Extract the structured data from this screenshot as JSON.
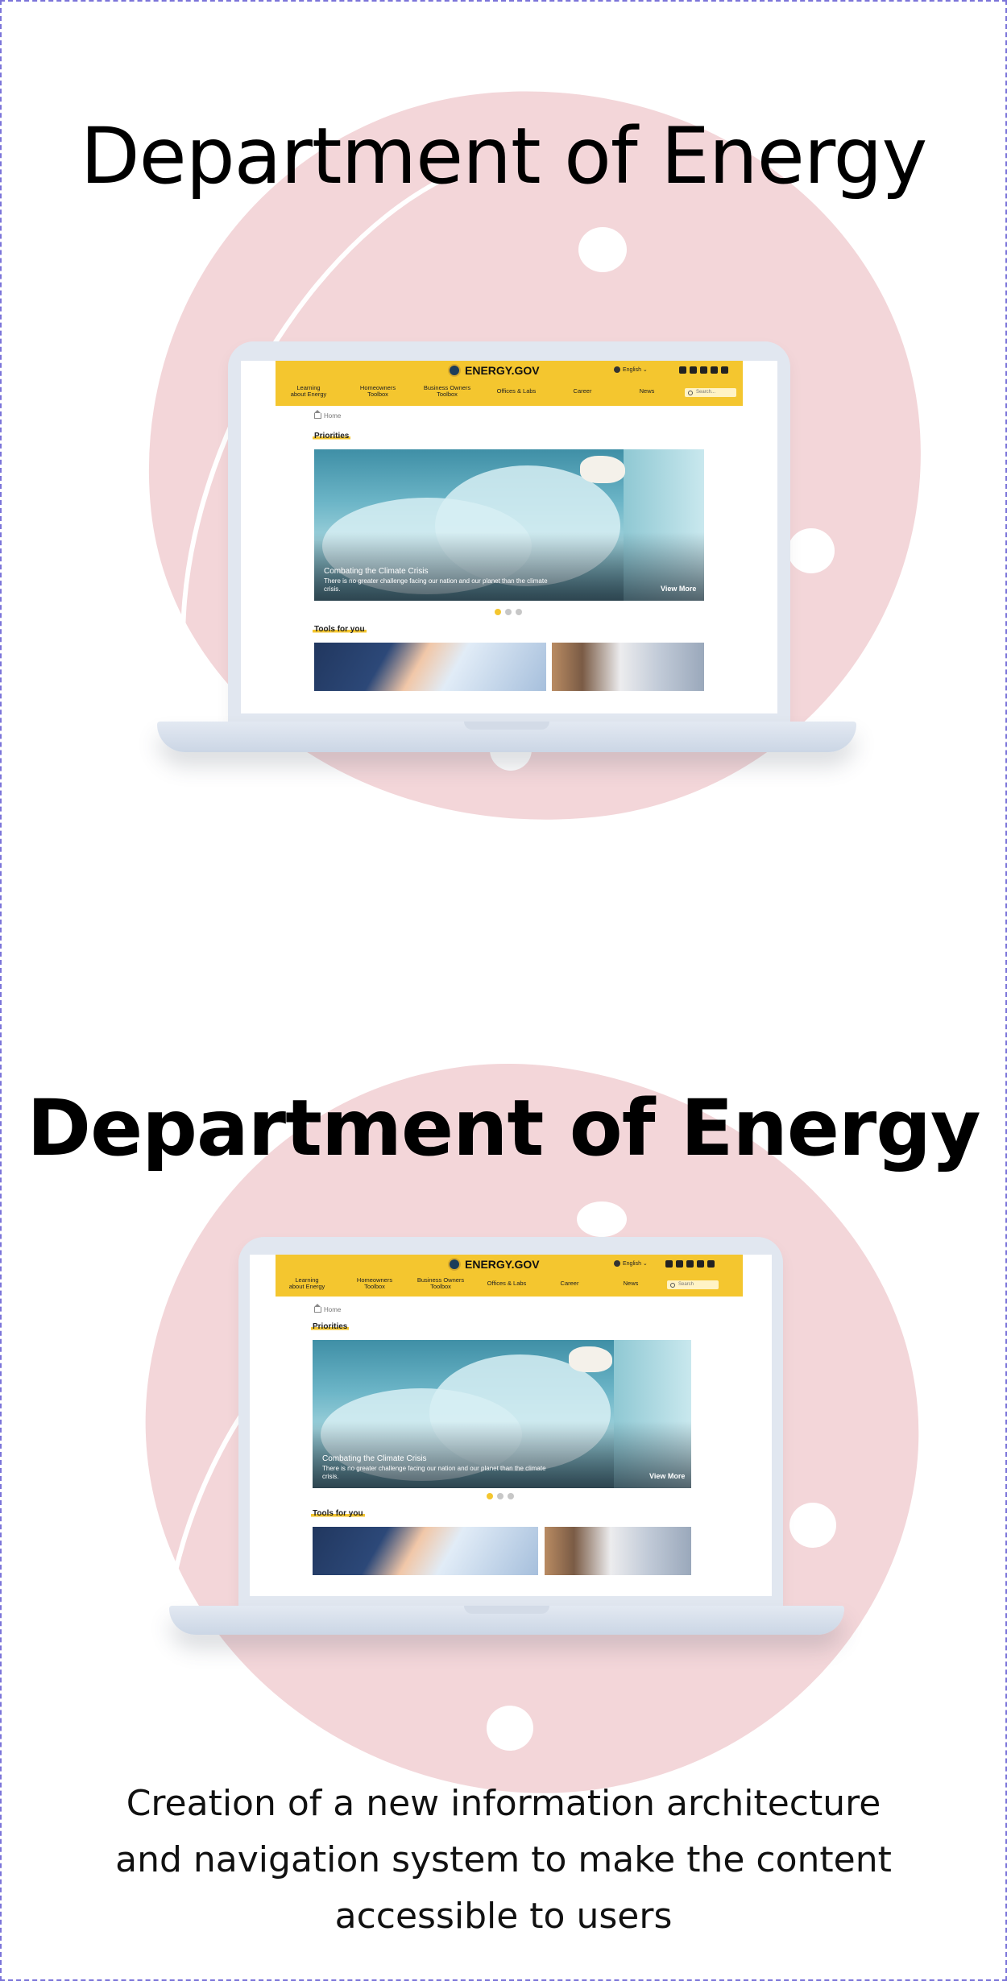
{
  "sections": [
    {
      "title": "Department of Energy",
      "site": {
        "logo": "ENERGY.GOV",
        "language": "English ⌄",
        "nav": [
          "Learning\nabout Energy",
          "Homeowners\nToolbox",
          "Business Owners\nToolbox",
          "Offices & Labs",
          "Career",
          "News"
        ],
        "search_placeholder": "Search...",
        "breadcrumb": "Home",
        "priorities_heading": "Priorities",
        "hero_title": "Combating the Climate Crisis",
        "hero_desc": "There is no greater challenge facing our nation and our planet than the climate crisis.",
        "view_more": "View More",
        "tools_heading": "Tools for you"
      }
    },
    {
      "title": "Department of Energy",
      "site": {
        "logo": "ENERGY.GOV",
        "language": "English ⌄",
        "nav": [
          "Learning\nabout Energy",
          "Homeowners\nToolbox",
          "Business Owners\nToolbox",
          "Offices & Labs",
          "Career",
          "News"
        ],
        "search_placeholder": "Search",
        "breadcrumb": "Home",
        "priorities_heading": "Priorities",
        "hero_title": "Combating the Climate Crisis",
        "hero_desc": "There is no greater challenge facing our nation and our planet than the climate crisis.",
        "view_more": "View More",
        "tools_heading": "Tools for you"
      }
    }
  ],
  "caption": "Creation of a new information architecture and navigation system to make the content accessible to users",
  "colors": {
    "accent": "#f4c62f",
    "blob": "#f3d6d9",
    "border": "#7b74d9"
  }
}
